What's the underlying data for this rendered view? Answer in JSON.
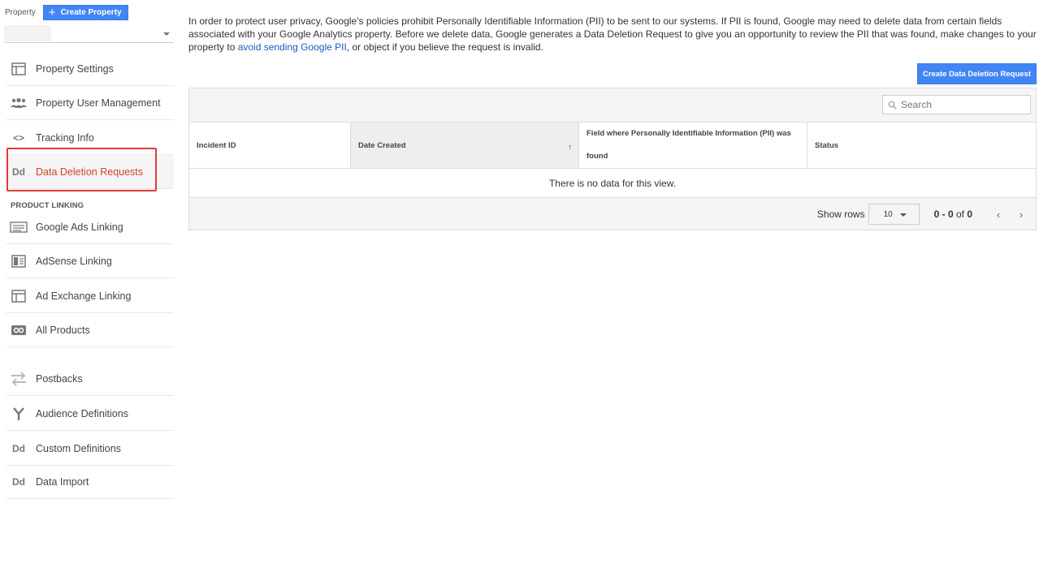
{
  "property": {
    "label": "Property",
    "create_button": "Create Property",
    "create_button_plus": "+"
  },
  "sidebar": {
    "items": [
      {
        "label": "Property Settings"
      },
      {
        "label": "Property User Management"
      },
      {
        "label": "Tracking Info",
        "icon_text": "<>"
      },
      {
        "label": "Data Deletion Requests",
        "icon_text": "Dd"
      }
    ],
    "section_product_linking": "PRODUCT LINKING",
    "linking_items": [
      {
        "label": "Google Ads Linking"
      },
      {
        "label": "AdSense Linking"
      },
      {
        "label": "Ad Exchange Linking"
      },
      {
        "label": "All Products"
      }
    ],
    "other_items": [
      {
        "label": "Postbacks"
      },
      {
        "label": "Audience Definitions"
      },
      {
        "label": "Custom Definitions",
        "icon_text": "Dd"
      },
      {
        "label": "Data Import",
        "icon_text": "Dd"
      }
    ]
  },
  "main": {
    "intro_text": "In order to protect user privacy, Google's policies prohibit Personally Identifiable Information (PII) to be sent to our systems. If PII is found, Google may need to delete data from certain fields associated with your Google Analytics property. Before we delete data, Google generates a Data Deletion Request to give you an opportunity to review the PII that was found, make changes to your property to ",
    "intro_link": "avoid sending Google PII",
    "intro_tail": ", or object if you believe the request is invalid.",
    "create_request_button": "Create Data Deletion Request",
    "search_placeholder": "Search",
    "columns": [
      "Incident ID",
      "Date Created",
      "Field where Personally Identifiable Information (PII) was found",
      "Status"
    ],
    "sort_indicator": "↑",
    "empty_message": "There is no data for this view.",
    "pager": {
      "show_rows_label": "Show rows",
      "rows_value": "10",
      "range_start": "0",
      "range_sep": " - ",
      "range_end": "0",
      "range_of": " of ",
      "range_total": "0",
      "prev": "‹",
      "next": "›"
    }
  },
  "colors": {
    "accent_blue": "#4285f4",
    "active_red": "#d23f31",
    "highlight_red": "#e53935",
    "link_blue": "#1a5ac8"
  }
}
